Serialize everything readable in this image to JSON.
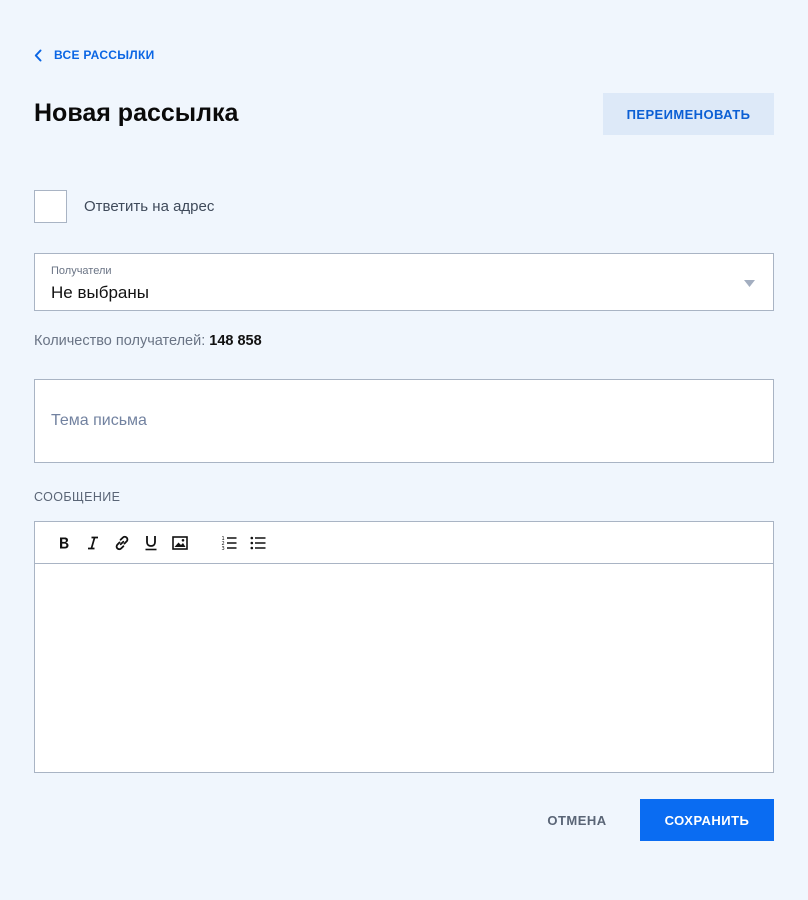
{
  "header": {
    "back_label": "ВСЕ РАССЫЛКИ",
    "title": "Новая рассылка",
    "rename_label": "ПЕРЕИМЕНОВАТЬ"
  },
  "form": {
    "reply_to_label": "Ответить на адрес",
    "recipients": {
      "label": "Получатели",
      "value": "Не выбраны"
    },
    "count": {
      "label": "Количество получателей:",
      "value": "148 858"
    },
    "subject_placeholder": "Тема письма",
    "message_label": "СООБЩЕНИЕ"
  },
  "editor": {
    "tools": [
      "bold-icon",
      "italic-icon",
      "link-icon",
      "underline-icon",
      "image-icon",
      "ordered-list-icon",
      "bullet-list-icon"
    ]
  },
  "footer": {
    "cancel_label": "ОТМЕНА",
    "save_label": "СОХРАНИТЬ"
  },
  "colors": {
    "accent": "#0a6cf2",
    "background": "#f0f6fd",
    "secondary_button": "#dde9f8"
  }
}
